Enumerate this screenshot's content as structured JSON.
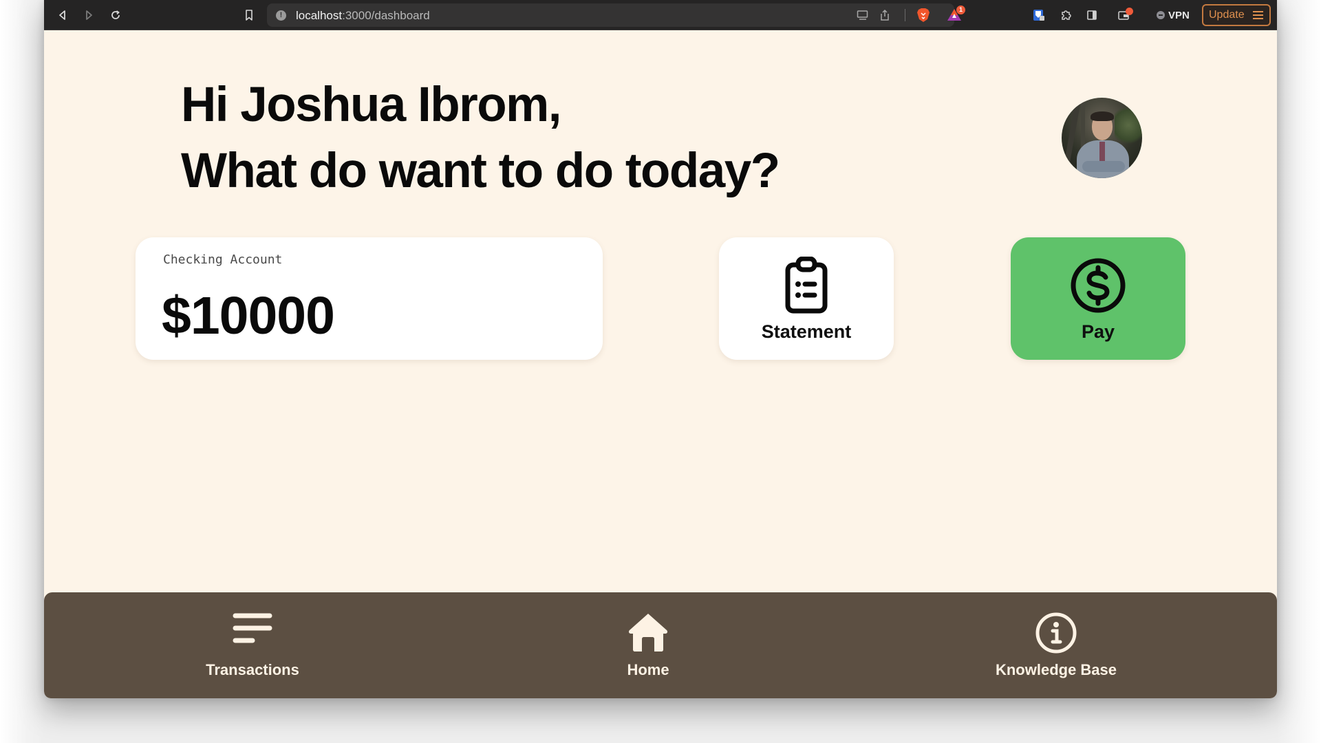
{
  "browser": {
    "url_host": "localhost",
    "url_rest": ":3000/dashboard",
    "notification_count": "1",
    "vpn_label": "VPN",
    "update_label": "Update"
  },
  "page": {
    "greeting_line1": "Hi Joshua Ibrom,",
    "greeting_line2": "What do want to do today?",
    "avatar_alt": "Joshua Ibrom profile photo"
  },
  "account": {
    "label": "Checking Account",
    "balance": "$10000"
  },
  "actions": [
    {
      "label": "Statement",
      "icon": "clipboard-list-icon",
      "color": "#ffffff"
    },
    {
      "label": "Pay",
      "icon": "dollar-circle-icon",
      "color": "#5fc26a"
    }
  ],
  "nav": [
    {
      "label": "Transactions",
      "icon": "list-lines-icon"
    },
    {
      "label": "Home",
      "icon": "home-icon"
    },
    {
      "label": "Knowledge Base",
      "icon": "info-circle-icon"
    }
  ],
  "colors": {
    "background": "#fdf4e8",
    "nav_bar": "#5c4f42",
    "nav_text": "#fdf2e4",
    "pay_green": "#5fc26a",
    "update_orange": "#e0914f"
  }
}
